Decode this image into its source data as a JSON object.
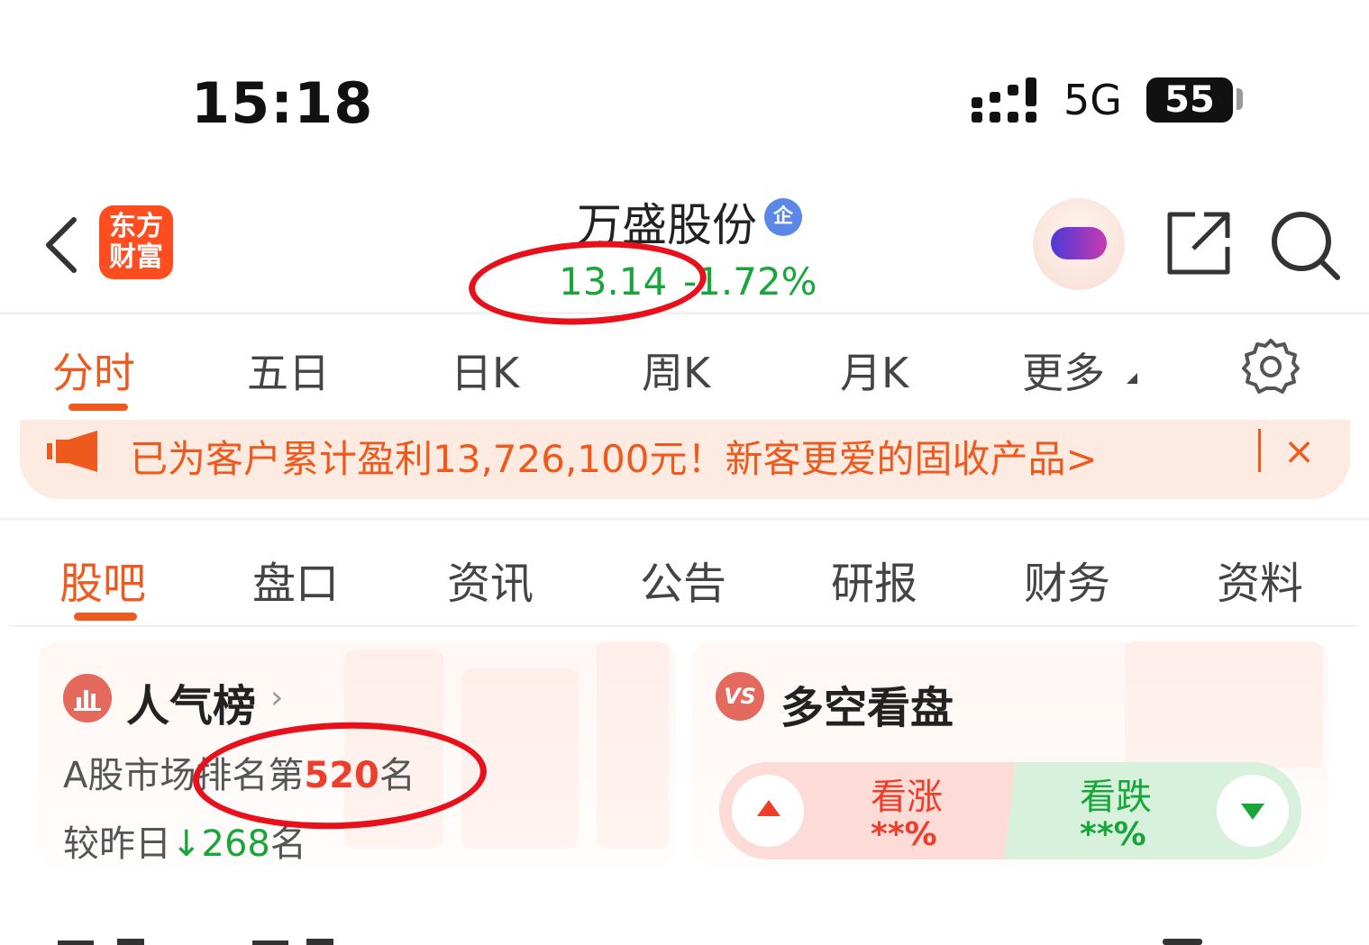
{
  "status_bar": {
    "time": "15:18",
    "network": "5G",
    "battery": "55"
  },
  "header": {
    "logo_line1": "东方",
    "logo_line2": "财富",
    "stock_name": "万盛股份",
    "enterprise_badge": "企",
    "price": "13.14",
    "change_pct": "-1.72%"
  },
  "chart_tabs": [
    "分时",
    "五日",
    "日K",
    "周K",
    "月K",
    "更多"
  ],
  "banner": {
    "text": "已为客户累计盈利13,726,100元！新客更爱的固收产品>",
    "close": "×"
  },
  "sub_tabs": [
    "股吧",
    "盘口",
    "资讯",
    "公告",
    "研报",
    "财务",
    "资料"
  ],
  "popularity": {
    "title": "人气榜",
    "arrow": "›",
    "rank_prefix": "A股市场排名第",
    "rank_value": "520",
    "rank_suffix": "名",
    "compare_prefix": "较昨日",
    "compare_arrow": "↓",
    "compare_value": "268",
    "compare_suffix": "名"
  },
  "sentiment": {
    "icon_text": "VS",
    "title": "多空看盘",
    "up_label": "看涨",
    "up_value": "**%",
    "down_label": "看跌",
    "down_value": "**%"
  },
  "colors": {
    "accent": "#ee5a1e",
    "down_green": "#18a63a",
    "up_red": "#ee3d2a",
    "annotation": "#e8101a"
  }
}
